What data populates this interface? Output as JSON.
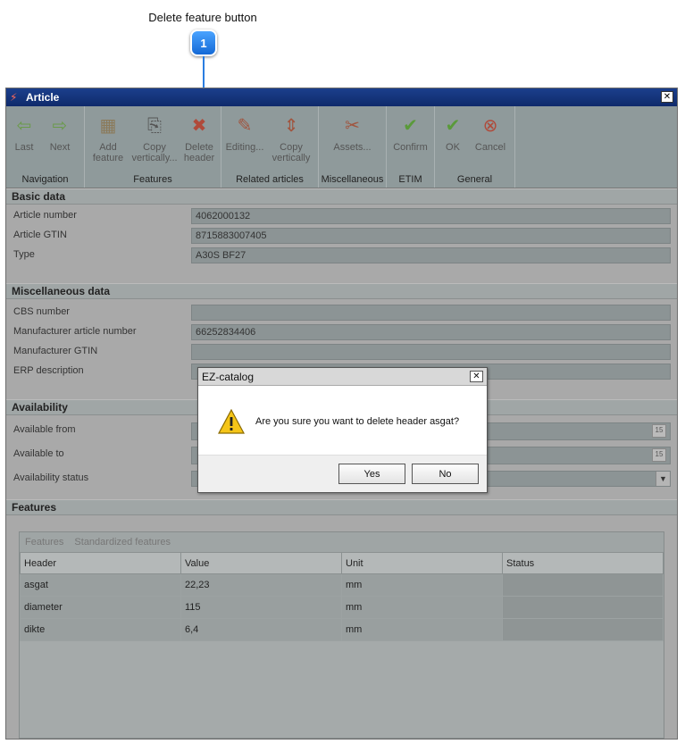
{
  "annotation": {
    "label": "Delete feature button",
    "badge": "1"
  },
  "window": {
    "title": "Article",
    "close": "✕"
  },
  "ribbon": {
    "groups": [
      {
        "label": "Navigation",
        "buttons": [
          {
            "label": "Last",
            "icon": "arrow-left-icon"
          },
          {
            "label": "Next",
            "icon": "arrow-right-icon"
          }
        ]
      },
      {
        "label": "Features",
        "buttons": [
          {
            "label": "Add feature",
            "icon": "add-feature-icon"
          },
          {
            "label": "Copy vertically...",
            "icon": "copy-vertically-icon"
          },
          {
            "label": "Delete header",
            "icon": "delete-header-icon"
          }
        ]
      },
      {
        "label": "Related articles",
        "buttons": [
          {
            "label": "Editing...",
            "icon": "editing-icon"
          },
          {
            "label": "Copy vertically",
            "icon": "copy-vertically-icon"
          }
        ]
      },
      {
        "label": "Miscellaneous",
        "buttons": [
          {
            "label": "Assets...",
            "icon": "assets-icon"
          }
        ]
      },
      {
        "label": "ETIM",
        "buttons": [
          {
            "label": "Confirm",
            "icon": "check-icon"
          }
        ]
      },
      {
        "label": "General",
        "buttons": [
          {
            "label": "OK",
            "icon": "check-icon"
          },
          {
            "label": "Cancel",
            "icon": "cancel-icon"
          }
        ]
      }
    ]
  },
  "basic": {
    "title": "Basic data",
    "article_number_label": "Article number",
    "article_number": "4062000132",
    "gtin_label": "Article GTIN",
    "gtin": "8715883007405",
    "type_label": "Type",
    "type": "A30S BF27"
  },
  "misc": {
    "title": "Miscellaneous data",
    "cbs_label": "CBS number",
    "cbs": "",
    "mfr_article_label": "Manufacturer article number",
    "mfr_article": "66252834406",
    "mfr_gtin_label": "Manufacturer GTIN",
    "mfr_gtin": "",
    "erp_label": "ERP description",
    "erp": ""
  },
  "availability": {
    "title": "Availability",
    "from_label": "Available from",
    "to_label": "Available to",
    "status_label": "Availability status",
    "calendar_glyph": "15"
  },
  "features": {
    "title": "Features",
    "tabs": [
      "Features",
      "Standardized features"
    ],
    "columns": [
      "Header",
      "Value",
      "Unit",
      "Status"
    ],
    "rows": [
      {
        "header": "asgat",
        "value": "22,23",
        "unit": "mm",
        "status": ""
      },
      {
        "header": "diameter",
        "value": "115",
        "unit": "mm",
        "status": ""
      },
      {
        "header": "dikte",
        "value": "6,4",
        "unit": "mm",
        "status": ""
      }
    ]
  },
  "dialog": {
    "title": "EZ-catalog",
    "close": "✕",
    "message": "Are you sure you want to delete header asgat?",
    "yes": "Yes",
    "no": "No"
  }
}
